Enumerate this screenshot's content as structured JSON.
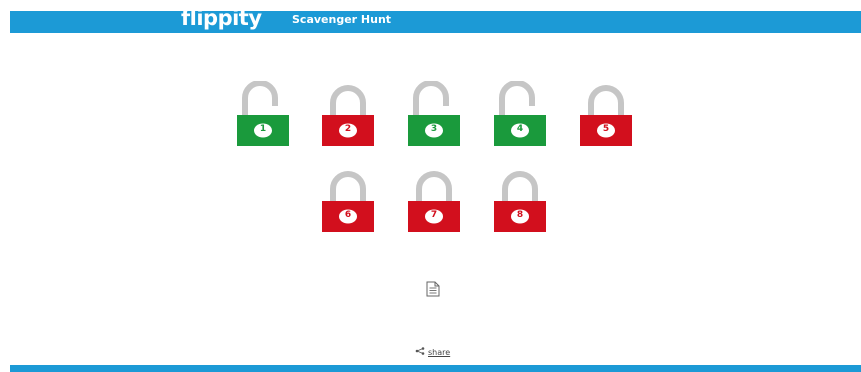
{
  "header": {
    "logo": "flippity",
    "title": "Scavenger Hunt"
  },
  "locks": [
    {
      "number": "1",
      "color": "#1a9a3c",
      "state": "open"
    },
    {
      "number": "2",
      "color": "#d20f1d",
      "state": "closed"
    },
    {
      "number": "3",
      "color": "#1a9a3c",
      "state": "open"
    },
    {
      "number": "4",
      "color": "#1a9a3c",
      "state": "open"
    },
    {
      "number": "5",
      "color": "#d20f1d",
      "state": "closed"
    },
    {
      "number": "6",
      "color": "#d20f1d",
      "state": "closed"
    },
    {
      "number": "7",
      "color": "#d20f1d",
      "state": "closed"
    },
    {
      "number": "8",
      "color": "#d20f1d",
      "state": "closed"
    }
  ],
  "footer": {
    "share_label": "share",
    "share_icon": "share-icon",
    "doc_icon": "document-icon"
  },
  "colors": {
    "brand": "#1c9ad6",
    "open": "#1a9a3c",
    "closed": "#d20f1d",
    "shackle": "#c6c6c6"
  }
}
